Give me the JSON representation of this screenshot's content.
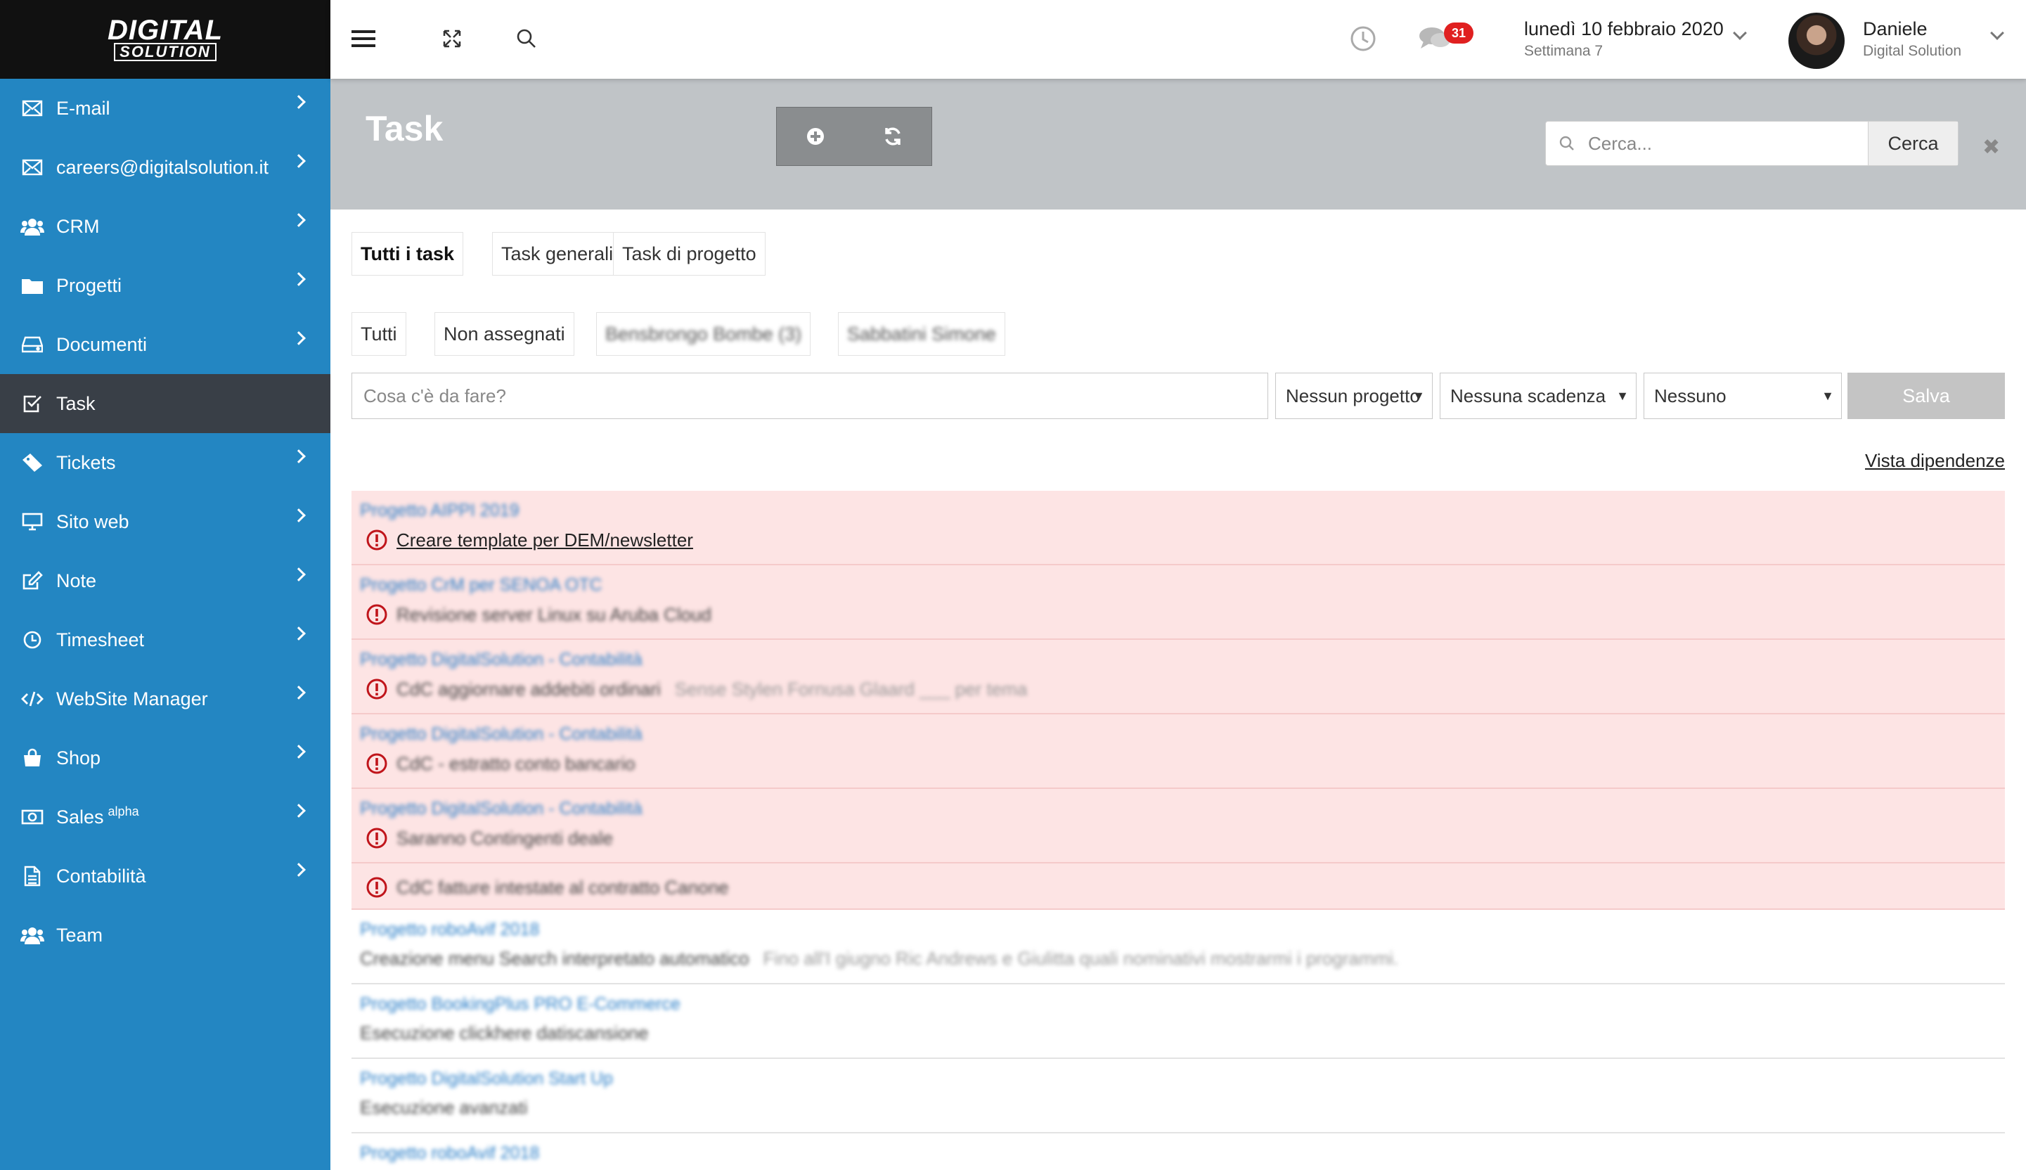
{
  "brand": {
    "line1": "DIGITAL",
    "line2": "SOLUTION"
  },
  "sidebar": {
    "items": [
      {
        "label": "E-mail",
        "icon": "envelope-icon"
      },
      {
        "label": "careers@digitalsolution.it",
        "icon": "envelope-icon"
      },
      {
        "label": "CRM",
        "icon": "users-icon"
      },
      {
        "label": "Progetti",
        "icon": "folder-icon"
      },
      {
        "label": "Documenti",
        "icon": "drive-icon"
      },
      {
        "label": "Task",
        "icon": "checkbox-icon",
        "active": true
      },
      {
        "label": "Tickets",
        "icon": "ticket-icon"
      },
      {
        "label": "Sito web",
        "icon": "monitor-icon"
      },
      {
        "label": "Note",
        "icon": "edit-icon"
      },
      {
        "label": "Timesheet",
        "icon": "clock-icon"
      },
      {
        "label": "WebSite Manager",
        "icon": "code-icon"
      },
      {
        "label": "Shop",
        "icon": "shopping-bag-icon"
      },
      {
        "label": "Sales",
        "sup": "alpha",
        "icon": "money-icon"
      },
      {
        "label": "Contabilità",
        "icon": "document-icon"
      },
      {
        "label": "Team",
        "icon": "users-icon"
      }
    ]
  },
  "topbar": {
    "notification_count": "31",
    "date": "lunedì 10 febbraio 2020",
    "week": "Settimana 7",
    "user_name": "Daniele",
    "user_company": "Digital Solution"
  },
  "header": {
    "title": "Task",
    "search_placeholder": "Cerca...",
    "search_button": "Cerca",
    "close": "✖"
  },
  "tabs": [
    "Tutti i task",
    "Task generali",
    "Task di progetto"
  ],
  "filters": [
    "Tutti",
    "Non assegnati",
    "Bensbrongo Bombe (3)",
    "Sabbatini Simone"
  ],
  "form": {
    "todo_placeholder": "Cosa c'è da fare?",
    "project_select": "Nessun progetto",
    "deadline_select": "Nessuna scadenza",
    "assignee_select": "Nessuno",
    "save": "Salva"
  },
  "dependency_link": "Vista dipendenze",
  "tasks": [
    {
      "project": "Progetto AIPPI 2019",
      "title": "Creare template per DEM/newsletter",
      "overdue": true,
      "blurred": false
    },
    {
      "project": "Progetto CrM per SENOA OTC",
      "title": "Revisione server Linux su Aruba Cloud",
      "overdue": true,
      "blurred": true
    },
    {
      "project": "Progetto DigitalSolution - Contabilità",
      "title": "CdC aggiornare addebiti ordinari",
      "desc": "Sense Stylen Fornusa Glaard ___ per tema",
      "overdue": true,
      "blurred": true
    },
    {
      "project": "Progetto DigitalSolution - Contabilità",
      "title": "CdC - estratto conto bancario",
      "overdue": true,
      "blurred": true
    },
    {
      "project": "Progetto DigitalSolution - Contabilità",
      "title": "Saranno Contingenti deale",
      "overdue": true,
      "blurred": true
    },
    {
      "project": "",
      "title": "CdC fatture intestate al contratto Canone",
      "overdue": true,
      "blurred": true,
      "single": true
    },
    {
      "project": "Progetto roboAvif 2018",
      "title": "Creazione menu Search interpretato automatico",
      "desc": "Fino all'I giugno Ric Andrews e Giulitta quali nominativi mostrarmi i programmi.",
      "overdue": false,
      "blurred": true
    },
    {
      "project": "Progetto BookingPlus PRO E-Commerce",
      "title": "Esecuzione clickhere datiscansione",
      "overdue": false,
      "blurred": true
    },
    {
      "project": "Progetto DigitalSolution Start Up",
      "title": "Esecuzione avanzati",
      "overdue": false,
      "blurred": true
    },
    {
      "project": "Progetto roboAvif 2018",
      "title": "",
      "overdue": false,
      "blurred": true
    }
  ]
}
